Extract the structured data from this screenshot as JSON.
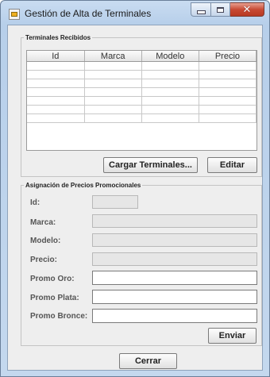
{
  "window": {
    "title": "Gestión de Alta de Terminales"
  },
  "received": {
    "legend": "Terminales Recibidos",
    "columns": [
      "Id",
      "Marca",
      "Modelo",
      "Precio"
    ],
    "row_count": 7,
    "load_button": "Cargar Terminales...",
    "edit_button": "Editar"
  },
  "promo": {
    "legend": "Asignación de Precios Promocionales",
    "id_label": "Id:",
    "brand_label": "Marca:",
    "model_label": "Modelo:",
    "price_label": "Precio:",
    "gold_label": "Promo Oro:",
    "silver_label": "Promo Plata:",
    "bronze_label": "Promo Bronce:",
    "id_value": "",
    "brand_value": "",
    "model_value": "",
    "price_value": "",
    "gold_value": "",
    "silver_value": "",
    "bronze_value": "",
    "send_button": "Enviar"
  },
  "close_button": "Cerrar"
}
